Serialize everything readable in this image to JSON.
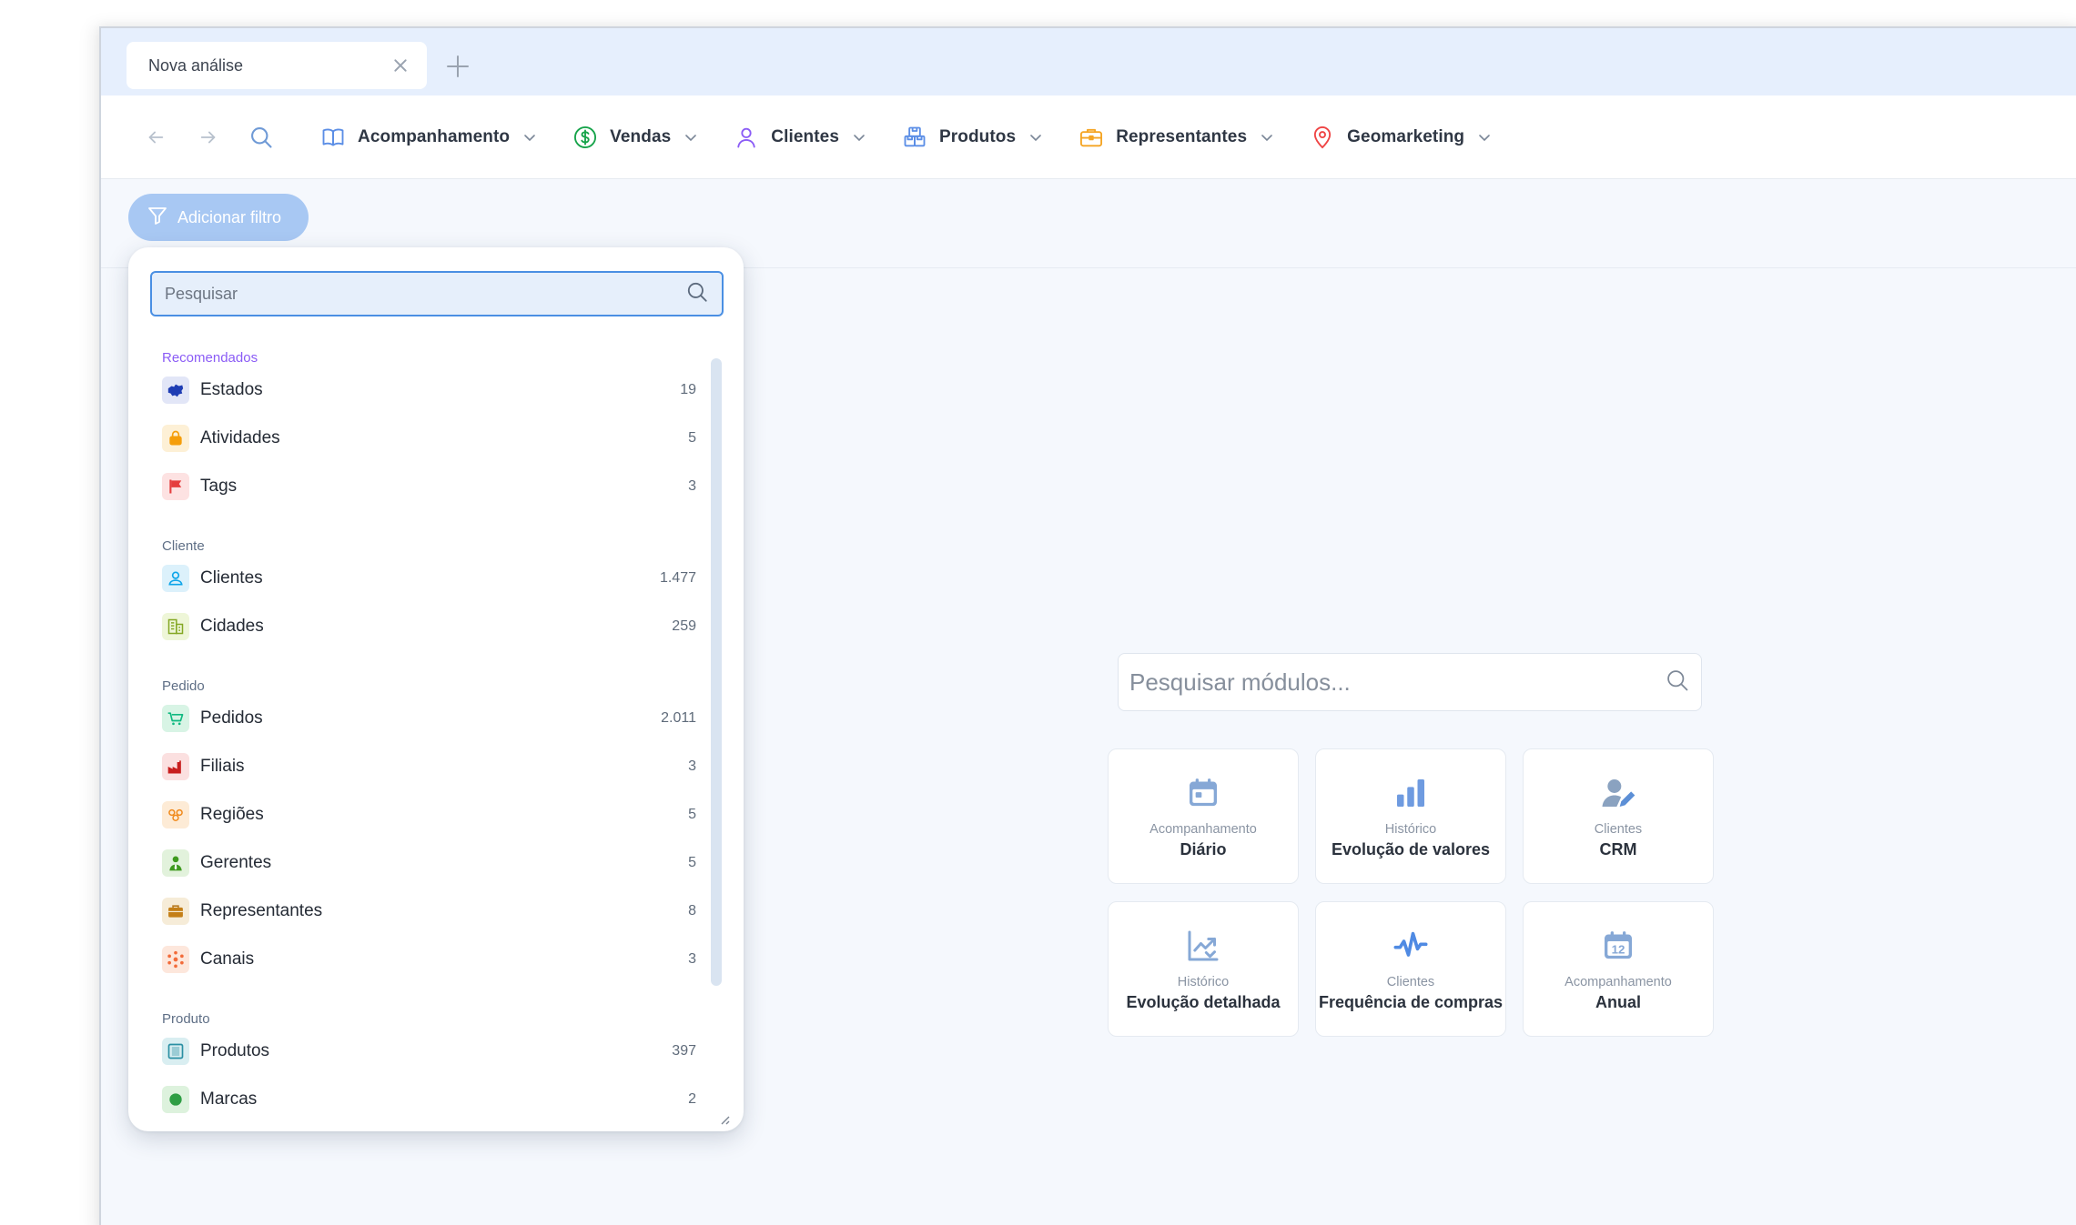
{
  "tabs": [
    {
      "title": "Nova análise"
    }
  ],
  "toolbar": {
    "menu": [
      {
        "label": "Acompanhamento",
        "icon": "book-open-icon",
        "color": "#5b8ee6"
      },
      {
        "label": "Vendas",
        "icon": "dollar-circle-icon",
        "color": "#16a34a"
      },
      {
        "label": "Clientes",
        "icon": "user-icon",
        "color": "#8b5cf6"
      },
      {
        "label": "Produtos",
        "icon": "boxes-icon",
        "color": "#5b8ee6"
      },
      {
        "label": "Representantes",
        "icon": "briefcase-icon",
        "color": "#f5a524"
      },
      {
        "label": "Geomarketing",
        "icon": "map-pin-icon",
        "color": "#ef4444"
      }
    ]
  },
  "filter": {
    "button_label": "Adicionar filtro"
  },
  "dropdown": {
    "search_placeholder": "Pesquisar",
    "groups": [
      {
        "title": "Recomendados",
        "items": [
          {
            "label": "Estados",
            "count": "19",
            "icon": "map-states-icon"
          },
          {
            "label": "Atividades",
            "count": "5",
            "icon": "shopping-bag-icon"
          },
          {
            "label": "Tags",
            "count": "3",
            "icon": "flag-icon"
          }
        ]
      },
      {
        "title": "Cliente",
        "items": [
          {
            "label": "Clientes",
            "count": "1.477",
            "icon": "client-user-icon"
          },
          {
            "label": "Cidades",
            "count": "259",
            "icon": "building-icon"
          }
        ]
      },
      {
        "title": "Pedido",
        "items": [
          {
            "label": "Pedidos",
            "count": "2.011",
            "icon": "shopping-cart-icon"
          },
          {
            "label": "Filiais",
            "count": "3",
            "icon": "factory-icon"
          },
          {
            "label": "Regiões",
            "count": "5",
            "icon": "regions-pin-icon"
          },
          {
            "label": "Gerentes",
            "count": "5",
            "icon": "manager-icon"
          },
          {
            "label": "Representantes",
            "count": "8",
            "icon": "briefcase-icon"
          },
          {
            "label": "Canais",
            "count": "3",
            "icon": "channels-icon"
          }
        ]
      },
      {
        "title": "Produto",
        "items": [
          {
            "label": "Produtos",
            "count": "397",
            "icon": "product-box-icon"
          },
          {
            "label": "Marcas",
            "count": "2",
            "icon": "brand-icon"
          }
        ]
      }
    ]
  },
  "modules": {
    "search_placeholder": "Pesquisar módulos...",
    "cards": [
      {
        "category": "Acompanhamento",
        "title": "Diário",
        "icon": "calendar-icon"
      },
      {
        "category": "Histórico",
        "title": "Evolução de valores",
        "icon": "bar-chart-icon"
      },
      {
        "category": "Clientes",
        "title": "CRM",
        "icon": "user-edit-icon"
      },
      {
        "category": "Histórico",
        "title": "Evolução detalhada",
        "icon": "trend-chart-icon"
      },
      {
        "category": "Clientes",
        "title": "Frequência de compras",
        "icon": "pulse-icon"
      },
      {
        "category": "Acompanhamento",
        "title": "Anual",
        "icon": "calendar-12-icon"
      }
    ]
  }
}
